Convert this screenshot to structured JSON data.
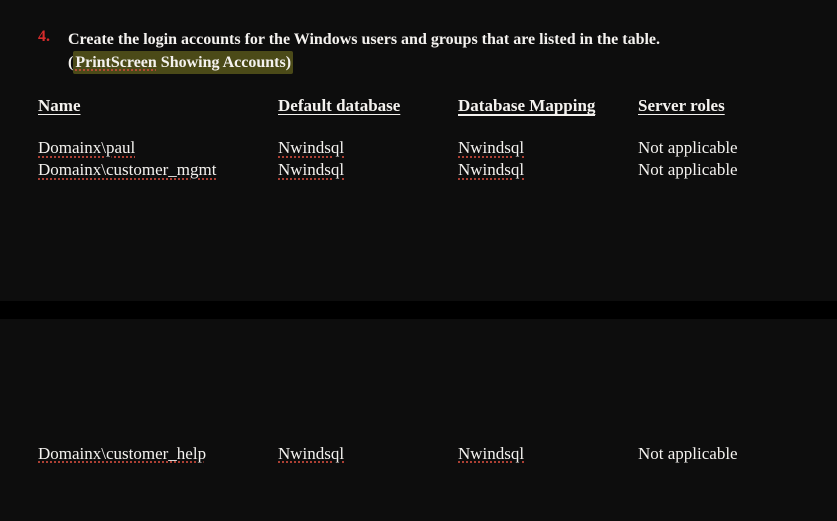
{
  "step": {
    "number": "4.",
    "text_main": "Create the login accounts for the Windows users and groups that are listed in the table.",
    "paren_open": "(",
    "print_label": "PrintScreen",
    "paren_rest": " Showing Accounts)",
    "highlight_full": "PrintScreen Showing Accounts"
  },
  "headers": {
    "name": "Name",
    "default_db": "Default database",
    "db_mapping": "Database Mapping",
    "server_roles": "Server roles"
  },
  "rows": [
    {
      "name": "Domainx\\paul",
      "default_db": "Nwindsql",
      "db_mapping": "Nwindsql",
      "server_roles": "Not applicable"
    },
    {
      "name": "Domainx\\customer_mgmt",
      "default_db": "Nwindsql",
      "db_mapping": "Nwindsql",
      "server_roles": "Not applicable"
    }
  ],
  "rows2": [
    {
      "name": "Domainx\\customer_help",
      "default_db": "Nwindsql",
      "db_mapping": "Nwindsql",
      "server_roles": "Not applicable"
    }
  ]
}
